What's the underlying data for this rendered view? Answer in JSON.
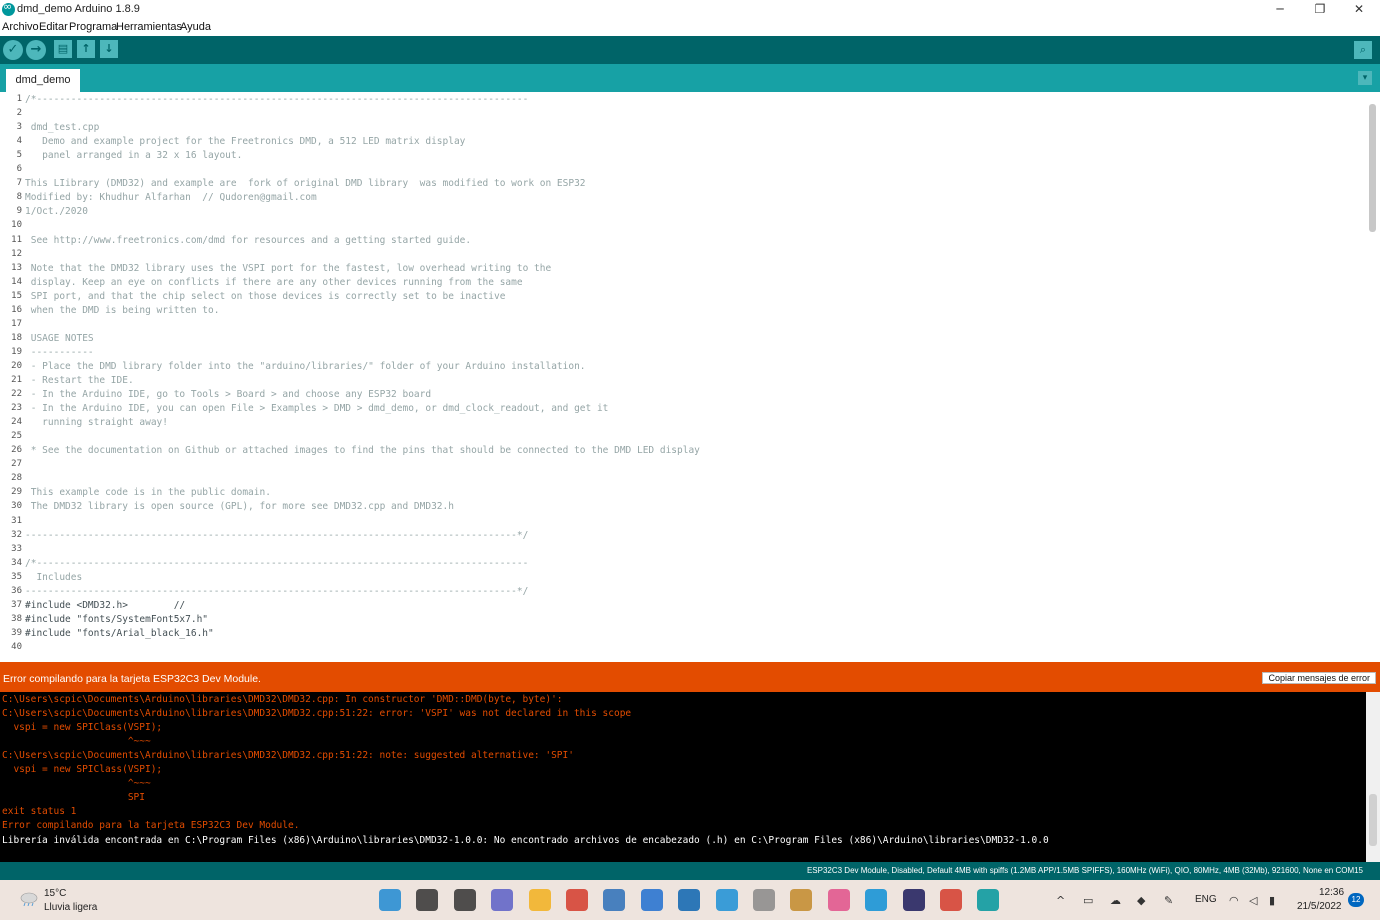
{
  "window": {
    "title": "dmd_demo Arduino 1.8.9",
    "minimize": "─",
    "restore": "❐",
    "close": "✕"
  },
  "menu": [
    "Archivo",
    "Editar",
    "Programa",
    "Herramientas",
    "Ayuda"
  ],
  "toolbar": {
    "verify_icon": "✓",
    "upload_icon": "→",
    "new_icon": "▤",
    "open_icon": "↑",
    "save_icon": "↓",
    "serial_icon": "⌕"
  },
  "tabs": [
    {
      "label": "dmd_demo"
    }
  ],
  "tab_menu_icon": "▾",
  "editor": {
    "lines": [
      {
        "n": "1",
        "text": "/*--------------------------------------------------------------------------------------"
      },
      {
        "n": "2",
        "text": ""
      },
      {
        "n": "3",
        "text": " dmd_test.cpp"
      },
      {
        "n": "4",
        "text": "   Demo and example project for the Freetronics DMD, a 512 LED matrix display"
      },
      {
        "n": "5",
        "text": "   panel arranged in a 32 x 16 layout."
      },
      {
        "n": "6",
        "text": ""
      },
      {
        "n": "7",
        "text": "This LIibrary (DMD32) and example are  fork of original DMD library  was modified to work on ESP32"
      },
      {
        "n": "8",
        "text": "Modified by: Khudhur Alfarhan  // Qudoren@gmail.com"
      },
      {
        "n": "9",
        "text": "1/Oct./2020"
      },
      {
        "n": "10",
        "text": ""
      },
      {
        "n": "11",
        "text": " See http://www.freetronics.com/dmd for resources and a getting started guide."
      },
      {
        "n": "12",
        "text": ""
      },
      {
        "n": "13",
        "text": " Note that the DMD32 library uses the VSPI port for the fastest, low overhead writing to the"
      },
      {
        "n": "14",
        "text": " display. Keep an eye on conflicts if there are any other devices running from the same"
      },
      {
        "n": "15",
        "text": " SPI port, and that the chip select on those devices is correctly set to be inactive"
      },
      {
        "n": "16",
        "text": " when the DMD is being written to."
      },
      {
        "n": "17",
        "text": ""
      },
      {
        "n": "18",
        "text": " USAGE NOTES"
      },
      {
        "n": "19",
        "text": " -----------"
      },
      {
        "n": "20",
        "text": " - Place the DMD library folder into the \"arduino/libraries/\" folder of your Arduino installation."
      },
      {
        "n": "21",
        "text": " - Restart the IDE."
      },
      {
        "n": "22",
        "text": " - In the Arduino IDE, go to Tools > Board > and choose any ESP32 board"
      },
      {
        "n": "23",
        "text": " - In the Arduino IDE, you can open File > Examples > DMD > dmd_demo, or dmd_clock_readout, and get it"
      },
      {
        "n": "24",
        "text": "   running straight away!"
      },
      {
        "n": "25",
        "text": ""
      },
      {
        "n": "26",
        "text": " * See the documentation on Github or attached images to find the pins that should be connected to the DMD LED display"
      },
      {
        "n": "27",
        "text": ""
      },
      {
        "n": "28",
        "text": ""
      },
      {
        "n": "29",
        "text": " This example code is in the public domain."
      },
      {
        "n": "30",
        "text": " The DMD32 library is open source (GPL), for more see DMD32.cpp and DMD32.h"
      },
      {
        "n": "31",
        "text": ""
      },
      {
        "n": "32",
        "text": "--------------------------------------------------------------------------------------*/"
      },
      {
        "n": "33",
        "text": ""
      },
      {
        "n": "34",
        "text": "/*--------------------------------------------------------------------------------------"
      },
      {
        "n": "35",
        "text": "  Includes"
      },
      {
        "n": "36",
        "text": "--------------------------------------------------------------------------------------*/"
      },
      {
        "n": "37",
        "text": "#include <DMD32.h>        //"
      },
      {
        "n": "38",
        "text": "#include \"fonts/SystemFont5x7.h\""
      },
      {
        "n": "39",
        "text": "#include \"fonts/Arial_black_16.h\""
      },
      {
        "n": "40",
        "text": ""
      }
    ]
  },
  "status": {
    "message": "Error compilando para la tarjeta ESP32C3 Dev Module.",
    "copy_button": "Copiar mensajes de error"
  },
  "console": {
    "lines": [
      {
        "text": "C:\\Users\\scpic\\Documents\\Arduino\\libraries\\DMD32\\DMD32.cpp: In constructor 'DMD::DMD(byte, byte)':",
        "color": "error"
      },
      {
        "text": "C:\\Users\\scpic\\Documents\\Arduino\\libraries\\DMD32\\DMD32.cpp:51:22: error: 'VSPI' was not declared in this scope",
        "color": "error"
      },
      {
        "text": "  vspi = new SPIClass(VSPI);",
        "color": "error"
      },
      {
        "text": "                      ^~~~",
        "color": "error"
      },
      {
        "text": "C:\\Users\\scpic\\Documents\\Arduino\\libraries\\DMD32\\DMD32.cpp:51:22: note: suggested alternative: 'SPI'",
        "color": "error"
      },
      {
        "text": "  vspi = new SPIClass(VSPI);",
        "color": "error"
      },
      {
        "text": "                      ^~~~",
        "color": "error"
      },
      {
        "text": "                      SPI",
        "color": "error"
      },
      {
        "text": "exit status 1",
        "color": "error"
      },
      {
        "text": "Error compilando para la tarjeta ESP32C3 Dev Module.",
        "color": "error"
      },
      {
        "text": "Librería inválida encontrada en C:\\Program Files (x86)\\Arduino\\libraries\\DMD32-1.0.0: No encontrado archivos de encabezado (.h) en C:\\Program Files (x86)\\Arduino\\libraries\\DMD32-1.0.0",
        "color": "white"
      }
    ]
  },
  "board_info": "ESP32C3 Dev Module, Disabled, Default 4MB with spiffs (1.2MB APP/1.5MB SPIFFS), 160MHz (WiFi), QIO, 80MHz, 4MB (32Mb), 921600, None en COM15",
  "taskbar": {
    "weather_temp": "15°C",
    "weather_desc": "Lluvia ligera",
    "language": "ENG",
    "time": "12:36",
    "date": "21/5/2022",
    "notifications": "12",
    "icons": [
      "windows-start",
      "search",
      "task-view",
      "teams-chat",
      "file-explorer",
      "chrome",
      "microsoft-store",
      "mail",
      "outlook",
      "remote-desktop",
      "app-m",
      "pen-app",
      "camera-app",
      "edge",
      "intellij",
      "chrome-2",
      "arduino"
    ]
  },
  "colors": {
    "teal_dark": "#006468",
    "teal": "#17a1a5",
    "error_orange": "#e34c00",
    "console_bg": "#000000"
  }
}
